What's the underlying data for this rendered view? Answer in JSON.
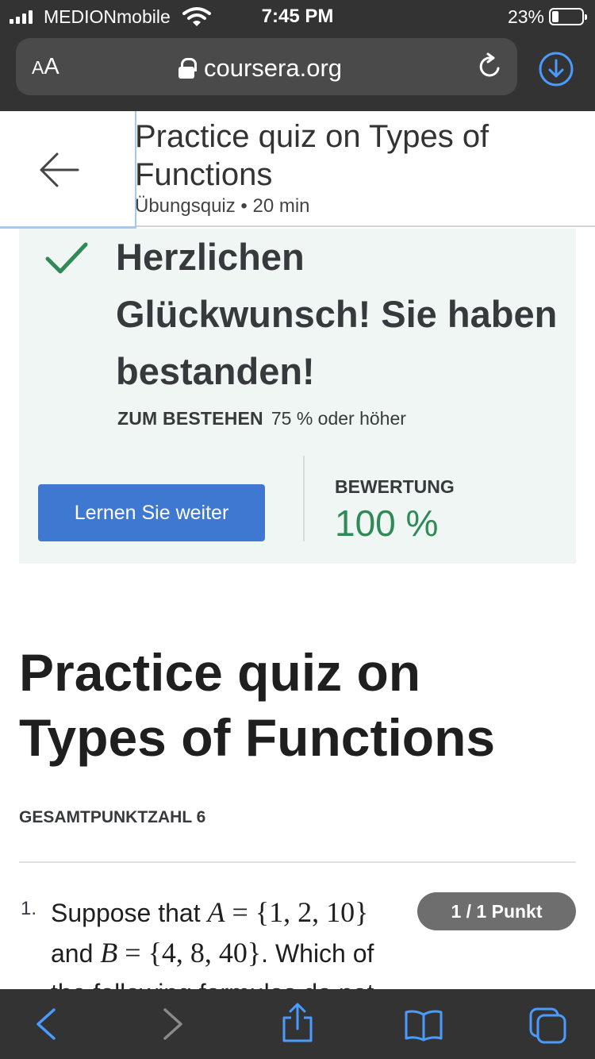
{
  "status_bar": {
    "carrier": "MEDIONmobile",
    "time": "7:45 PM",
    "battery_percent": "23%",
    "battery_level": 0.23
  },
  "browser": {
    "text_size_label_small": "A",
    "text_size_label_large": "A",
    "url": "coursera.org"
  },
  "quiz_header": {
    "title": "Practice quiz on Types of Functions",
    "meta": "Übungsquiz • 20 min"
  },
  "result": {
    "message": "Herzlichen Glückwunsch! Sie haben bestanden!",
    "pass_label": "ZUM BESTEHEN",
    "pass_value": "75 % oder höher",
    "continue_label": "Lernen Sie weiter",
    "grade_label": "BEWERTUNG",
    "grade_value": "100 %"
  },
  "main": {
    "title": "Practice quiz on Types of Functions",
    "total_points": "GESAMTPUNKTZAHL 6"
  },
  "question": {
    "number": "1.",
    "text_suppose": "Suppose that",
    "set_a_var": "A",
    "set_a_value": "= {1, 2, 10}",
    "text_and": "and",
    "set_b_var": "B",
    "set_b_value": "= {4, 8, 40}",
    "text_which": ". Which of",
    "text_next_line": "the following formulas do not",
    "points": "1 / 1 Punkt"
  },
  "colors": {
    "status_bar_bg": "#333333",
    "accent_blue": "#3f78d1",
    "success_green": "#2f8a57",
    "result_panel_bg": "#eff6f3"
  },
  "icons": {
    "back": "arrow-left-icon",
    "lock": "lock-icon",
    "reload": "reload-icon",
    "download": "download-icon",
    "check": "check-icon",
    "toolbar": [
      "chevron-left-icon",
      "chevron-right-icon",
      "share-icon",
      "bookmarks-icon",
      "tabs-icon"
    ]
  }
}
